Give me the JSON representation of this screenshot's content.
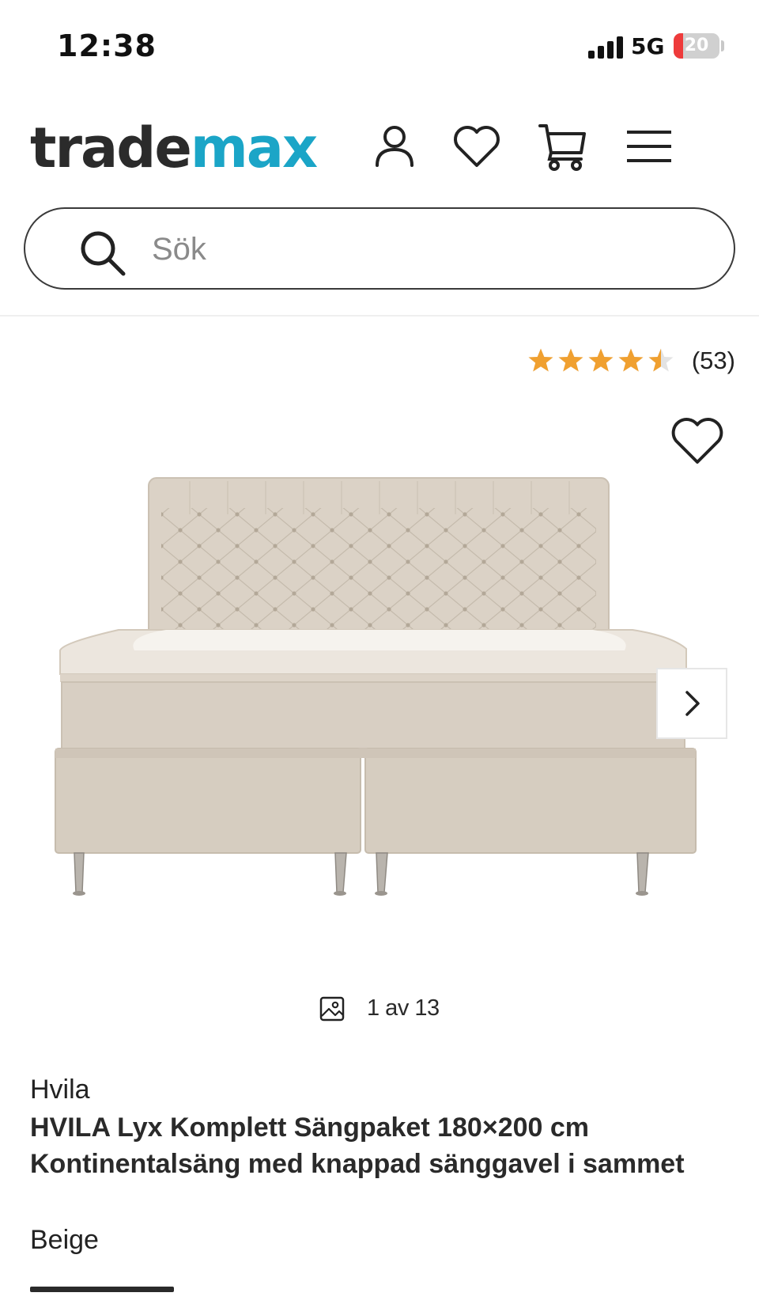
{
  "status_bar": {
    "time": "12:38",
    "network": "5G",
    "battery_level": "20",
    "battery_fraction": 0.2
  },
  "header": {
    "logo_part_1": "trade",
    "logo_part_2": "max",
    "icons": [
      "account-icon",
      "heart-icon",
      "cart-icon",
      "menu-icon"
    ]
  },
  "search": {
    "placeholder": "Sök",
    "value": ""
  },
  "rating": {
    "stars": 4.5,
    "count_label": "(53)"
  },
  "gallery": {
    "counter": "1 av 13"
  },
  "product": {
    "brand": "Hvila",
    "title": "HVILA Lyx Komplett Sängpaket 180×200 cm Kontinentalsäng med knappad sänggavel i sammet",
    "color": "Beige"
  },
  "colors": {
    "brand_dark": "#2b2b2b",
    "brand_accent": "#1ba5c7",
    "star": "#f0a030",
    "battery_low": "#ee3b3b",
    "fabric": "#d8cfc3"
  }
}
